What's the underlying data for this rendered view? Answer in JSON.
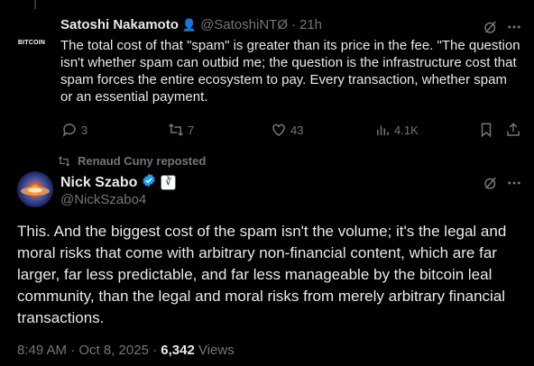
{
  "tweet1": {
    "avatar_text": "BITCOIN",
    "name": "Satoshi Nakamoto",
    "name_emoji": "👤",
    "handle": "@SatoshiNTØ",
    "separator": "·",
    "time": "21h",
    "text": "The total cost of that \"spam\" is greater than its price in the fee. \"The question isn't whether spam can outbid me; the question is the infrastructure cost that spam forces the entire ecosystem to pay. Every transaction, whether spam or an essential payment.",
    "replies": "3",
    "reposts": "7",
    "likes": "43",
    "views": "4.1K"
  },
  "repost_notice": "Renaud Cuny reposted",
  "tweet2": {
    "name": "Nick Szabo",
    "affiliate_badge": "∛",
    "handle": "@NickSzabo4",
    "text": "This.  And the biggest cost of the spam isn't the volume; it's the legal and moral risks that come with arbitrary non-financial content, which are far larger, far less predictable, and far less manageable by the bitcoin leal community, than the legal and moral risks from merely arbitrary financial transactions.",
    "timestamp": "8:49 AM · Oct 8, 2025 · ",
    "views_count": "6,342",
    "views_label": " Views"
  },
  "icons": [
    "grok-icon",
    "more-icon",
    "reply-icon",
    "repost-icon",
    "like-icon",
    "views-icon",
    "bookmark-icon",
    "share-icon",
    "verified-icon"
  ],
  "colors": {
    "background": "#000000",
    "text": "#e7e9ea",
    "muted": "#71767b",
    "verified": "#1d9bf0"
  }
}
